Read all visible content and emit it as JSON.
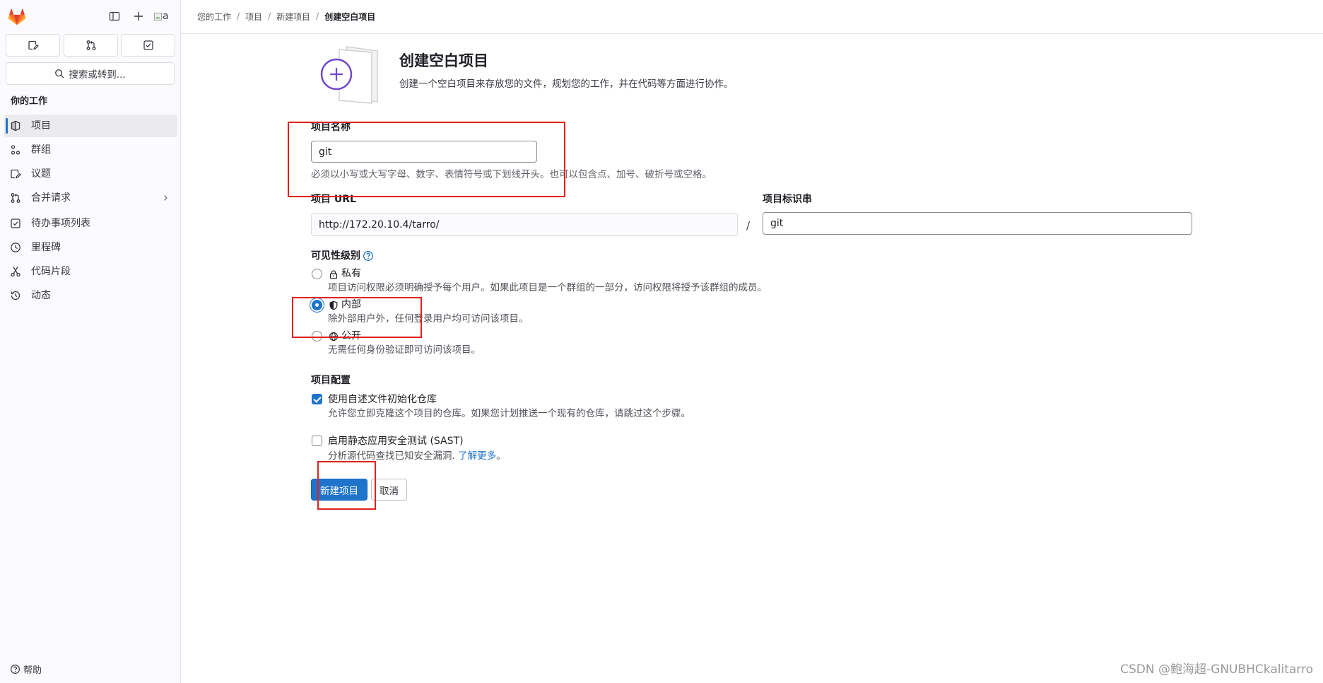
{
  "colors": {
    "accent": "#1f75cb",
    "brand": "#fc6d26",
    "illustration": "#6e49cb",
    "annotation": "#e02020"
  },
  "sidebar": {
    "avatar_alt": "a",
    "quick_actions": [
      {
        "icon": "issues-icon"
      },
      {
        "icon": "merge-request-icon"
      },
      {
        "icon": "todo-icon"
      }
    ],
    "search_placeholder": "搜索或转到...",
    "section_title": "你的工作",
    "items": [
      {
        "label": "项目",
        "icon": "project-icon",
        "active": true
      },
      {
        "label": "群组",
        "icon": "group-icon",
        "active": false
      },
      {
        "label": "议题",
        "icon": "issues-icon",
        "active": false
      },
      {
        "label": "合并请求",
        "icon": "merge-request-icon",
        "active": false,
        "expandable": true
      },
      {
        "label": "待办事项列表",
        "icon": "todo-icon",
        "active": false
      },
      {
        "label": "里程碑",
        "icon": "milestone-icon",
        "active": false
      },
      {
        "label": "代码片段",
        "icon": "snippet-icon",
        "active": false
      },
      {
        "label": "动态",
        "icon": "activity-icon",
        "active": false
      }
    ],
    "help_label": "帮助"
  },
  "breadcrumb": {
    "separator": "/",
    "items": [
      "您的工作",
      "项目",
      "新建项目",
      "创建空白项目"
    ]
  },
  "page": {
    "title": "创建空白项目",
    "description": "创建一个空白项目来存放您的文件，规划您的工作，并在代码等方面进行协作。"
  },
  "form": {
    "project_name": {
      "label": "项目名称",
      "value": "git",
      "help": "必须以小写或大写字母、数字、表情符号或下划线开头。也可以包含点、加号、破折号或空格。"
    },
    "project_url": {
      "label": "项目 URL",
      "value": "http://172.20.10.4/tarro/"
    },
    "url_separator": "/",
    "project_slug": {
      "label": "项目标识串",
      "value": "git"
    },
    "visibility": {
      "label": "可见性级别",
      "options": [
        {
          "label": "私有",
          "icon": "lock-icon",
          "checked": false,
          "description": "项目访问权限必须明确授予每个用户。如果此项目是一个群组的一部分，访问权限将授予该群组的成员。"
        },
        {
          "label": "内部",
          "icon": "shield-icon",
          "checked": true,
          "description": "除外部用户外，任何登录用户均可访问该项目。"
        },
        {
          "label": "公开",
          "icon": "globe-icon",
          "checked": false,
          "description": "无需任何身份验证即可访问该项目。"
        }
      ]
    },
    "config": {
      "label": "项目配置",
      "options": [
        {
          "label": "使用自述文件初始化仓库",
          "checked": true,
          "description": "允许您立即克隆这个项目的仓库。如果您计划推送一个现有的仓库，请跳过这个步骤。"
        },
        {
          "label": "启用静态应用安全测试 (SAST)",
          "checked": false,
          "description": "分析源代码查找已知安全漏洞.",
          "link": "了解更多",
          "suffix": "。"
        }
      ]
    },
    "submit_label": "新建项目",
    "cancel_label": "取消"
  },
  "watermark": "CSDN @鲍海超-GNUBHCkalitarro"
}
